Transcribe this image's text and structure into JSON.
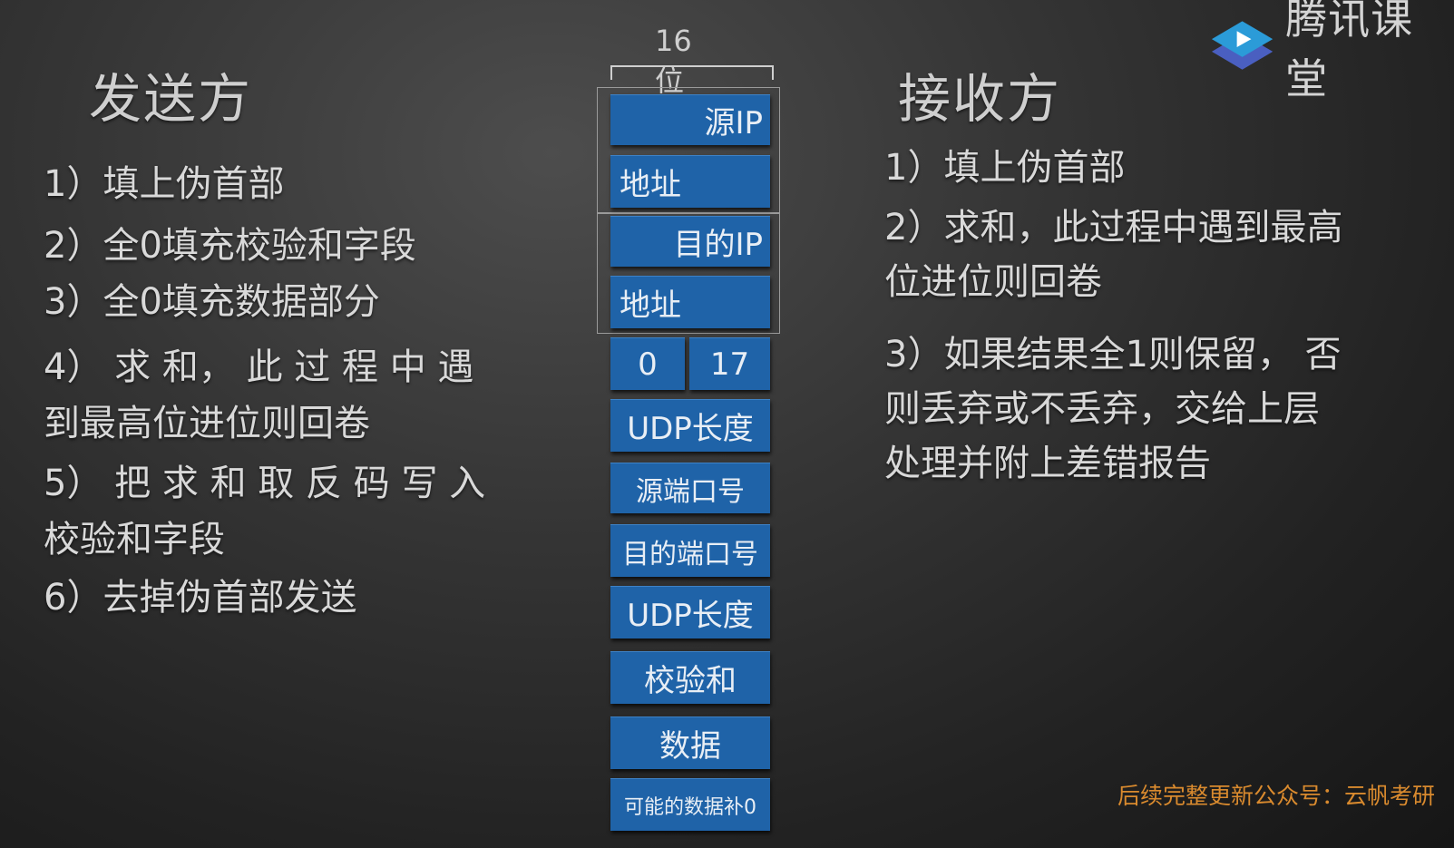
{
  "logo": {
    "text": "腾讯课堂",
    "icon": "tencent-classroom-play-icon",
    "color_primary": "#2b9bd8",
    "color_secondary": "#4a5fc0"
  },
  "sender": {
    "title": "发送方",
    "steps": [
      {
        "line1": "1）填上伪首部"
      },
      {
        "line1": "2）全0填充校验和字段"
      },
      {
        "line1": "3）全0填充数据部分"
      },
      {
        "line1": "4） 求 和， 此 过 程 中 遇",
        "line2": "到最高位进位则回卷"
      },
      {
        "line1": "5） 把 求 和 取 反 码 写 入",
        "line2": "校验和字段"
      },
      {
        "line1": "6）去掉伪首部发送"
      }
    ]
  },
  "receiver": {
    "title": "接收方",
    "steps": [
      {
        "line1": "1）填上伪首部"
      },
      {
        "line1": "2）求和，此过程中遇到最高",
        "line2": "位进位则回卷"
      },
      {
        "line1": "3）如果结果全1则保留， 否",
        "line2": "则丢弃或不丢弃，交给上层",
        "line3": "处理并附上差错报告"
      }
    ]
  },
  "diagram": {
    "bit_label": "16位",
    "cells": {
      "src_ip_top": "源IP",
      "src_ip_bottom": "地址",
      "dst_ip_top": "目的IP",
      "dst_ip_bottom": "地址",
      "zero": "0",
      "protocol": "17",
      "udp_length_pseudo": "UDP长度",
      "src_port": "源端口号",
      "dst_port": "目的端口号",
      "udp_length": "UDP长度",
      "checksum": "校验和",
      "data": "数据",
      "padding": "可能的数据补0"
    },
    "cell_color": "#1f63a8"
  },
  "footer_note": "后续完整更新公众号：云帆考研"
}
